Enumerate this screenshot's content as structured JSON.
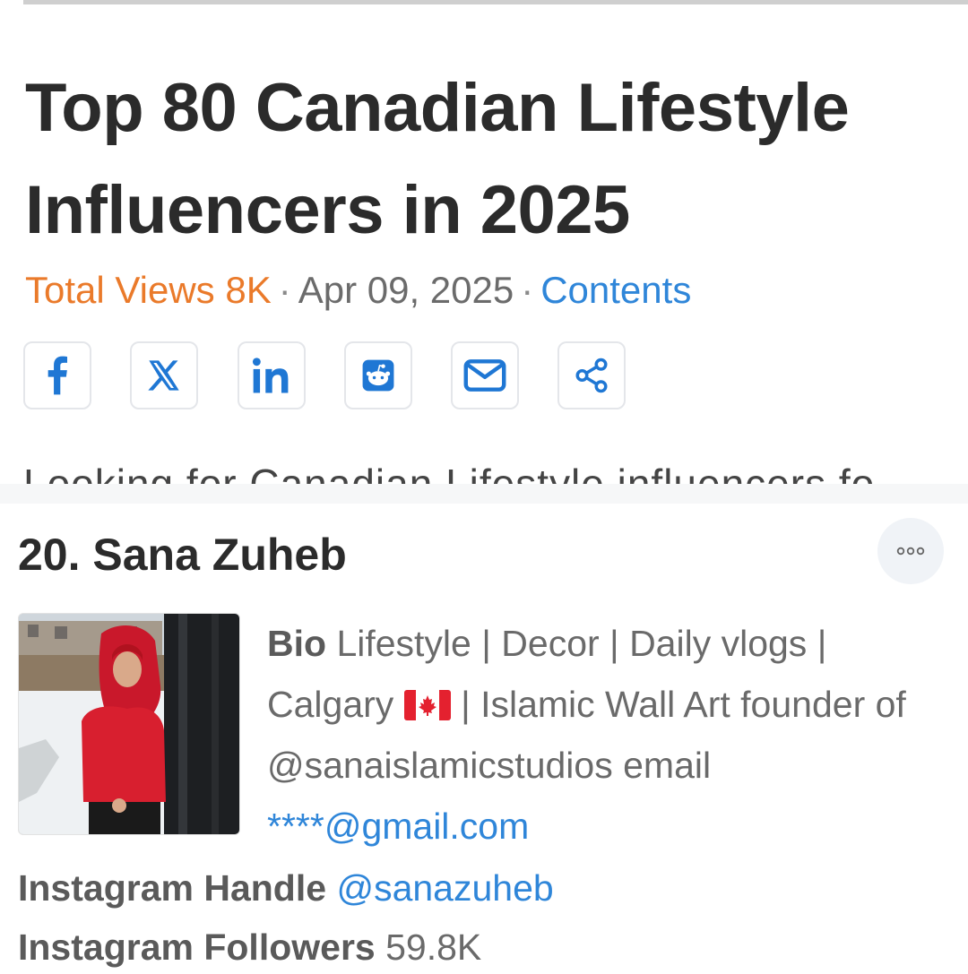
{
  "article": {
    "title": "Top 80 Canadian Lifestyle Influencers in 2025",
    "meta": {
      "views": "Total Views 8K",
      "separator": "·",
      "date": "Apr 09, 2025",
      "contents": "Contents"
    },
    "share_buttons": [
      {
        "name": "facebook-icon"
      },
      {
        "name": "x-icon"
      },
      {
        "name": "linkedin-icon"
      },
      {
        "name": "reddit-icon"
      },
      {
        "name": "email-icon"
      },
      {
        "name": "share-icon"
      }
    ],
    "intro_partial": "Looking for Canadian Lifestyle influencers fo"
  },
  "influencer": {
    "heading": "20. Sana Zuheb",
    "bio_label": "Bio",
    "bio_text_1": " Lifestyle | Decor | Daily vlogs | Calgary ",
    "bio_text_2": " | Islamic Wall Art founder of @sanaislamicstudios email ",
    "bio_email": "****@gmail.com",
    "handle_label": "Instagram Handle",
    "handle_value": "@sanazuheb",
    "followers_label": "Instagram Followers",
    "followers_value": "59.8K"
  },
  "colors": {
    "views_orange": "#ea7a2a",
    "link_blue": "#2f86d9",
    "icon_blue": "#1f77d4"
  }
}
